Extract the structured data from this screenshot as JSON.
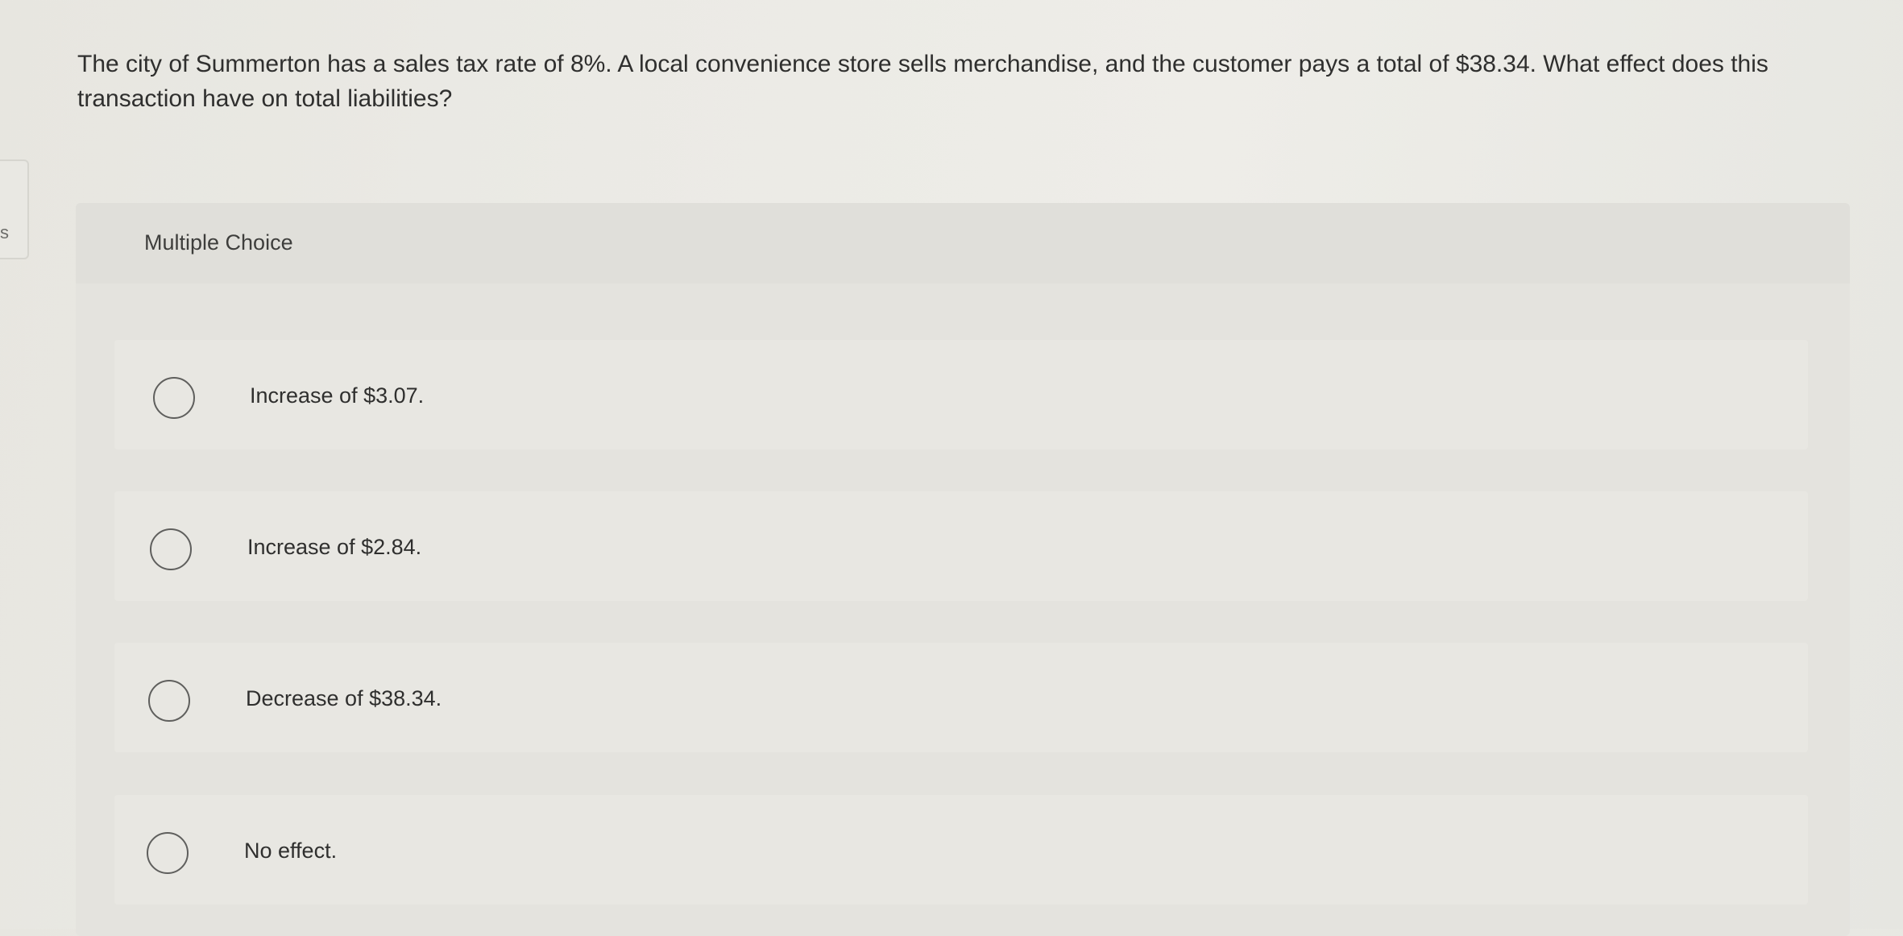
{
  "sidebar": {
    "tab_label": "s"
  },
  "question": {
    "text": "The city of Summerton has a sales tax rate of 8%. A local convenience store sells merchandise, and the customer pays a total of $38.34. What effect does this transaction have on total liabilities?"
  },
  "multiple_choice": {
    "label": "Multiple Choice",
    "options": [
      {
        "label": "Increase of $3.07."
      },
      {
        "label": "Increase of $2.84."
      },
      {
        "label": "Decrease of $38.34."
      },
      {
        "label": "No effect."
      }
    ]
  }
}
